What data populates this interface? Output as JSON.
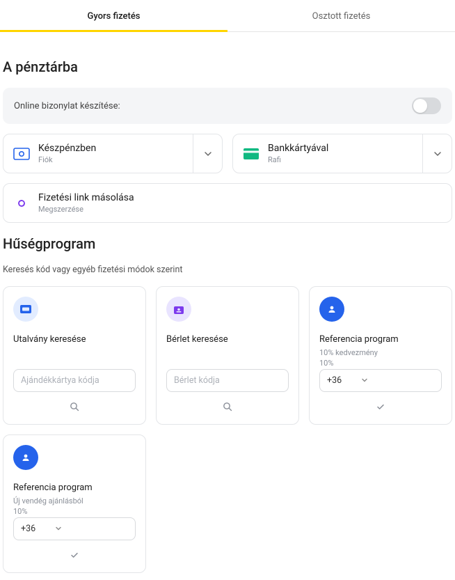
{
  "tabs": {
    "quick": "Gyors fizetés",
    "split": "Osztott fizetés"
  },
  "checkout": {
    "title": "A pénztárba",
    "receipt_toggle_label": "Online bizonylat készítése:"
  },
  "methods": {
    "cash": {
      "title": "Készpénzben",
      "sub": "Fiók"
    },
    "card": {
      "title": "Bankkártyával",
      "sub": "Rafi"
    },
    "link": {
      "title": "Fizetési link másolása",
      "sub": "Megszerzése"
    }
  },
  "loyalty": {
    "title": "Hűségprogram",
    "sub_heading": "Keresés kód vagy egyéb fizetési módok szerint",
    "voucher": {
      "title": "Utalvány keresése",
      "placeholder": "Ajándékkártya kódja"
    },
    "pass": {
      "title": "Bérlet keresése",
      "placeholder": "Bérlet kódja"
    },
    "referral1": {
      "title": "Referencia program",
      "sub": "10% kedvezmény",
      "pct": "10%",
      "dial": "+36"
    },
    "referral2": {
      "title": "Referencia program",
      "sub": "Új vendég ajánlásból",
      "pct": "10%",
      "dial": "+36"
    }
  }
}
